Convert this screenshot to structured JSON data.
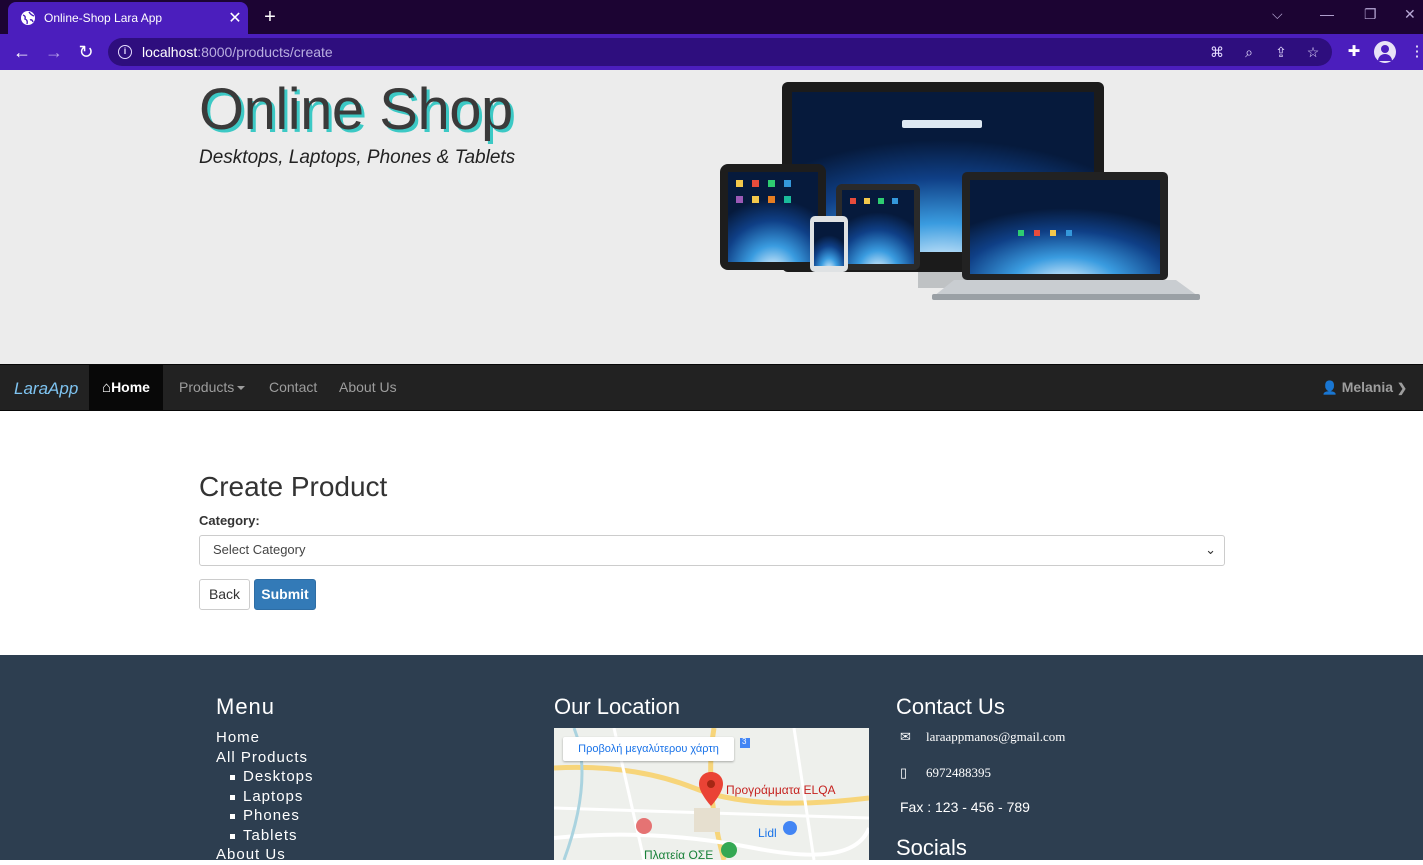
{
  "browser": {
    "tab_title": "Online-Shop Lara App",
    "url_host": "localhost",
    "url_rest": ":8000/products/create"
  },
  "hero": {
    "title": "Online Shop",
    "subtitle": "Desktops, Laptops, Phones & Tablets"
  },
  "navbar": {
    "brand": "LaraApp",
    "items": [
      {
        "label": "Home"
      },
      {
        "label": "Products"
      },
      {
        "label": "Contact"
      },
      {
        "label": "About Us"
      }
    ],
    "user": "Melania"
  },
  "form": {
    "title": "Create Product",
    "category_label": "Category:",
    "category_selected": "Select Category",
    "back_label": "Back",
    "submit_label": "Submit"
  },
  "footer": {
    "menu": {
      "heading": "Menu",
      "items": [
        "Home",
        "All Products",
        "Desktops",
        "Laptops",
        "Phones",
        "Tablets",
        "About Us"
      ]
    },
    "location": {
      "heading": "Our Location",
      "map_button": "Προβολή μεγαλύτερου χάρτη",
      "pin_label": "Προγράμματα ELQA",
      "lidl": "Lidl",
      "platia": "Πλατεία ΟΣΕ",
      "route": "3"
    },
    "contact": {
      "heading": "Contact Us",
      "email": "laraappmanos@gmail.com",
      "phone": "6972488395",
      "fax": "Fax : 123 - 456 - 789"
    },
    "socials": {
      "heading": "Socials"
    }
  }
}
